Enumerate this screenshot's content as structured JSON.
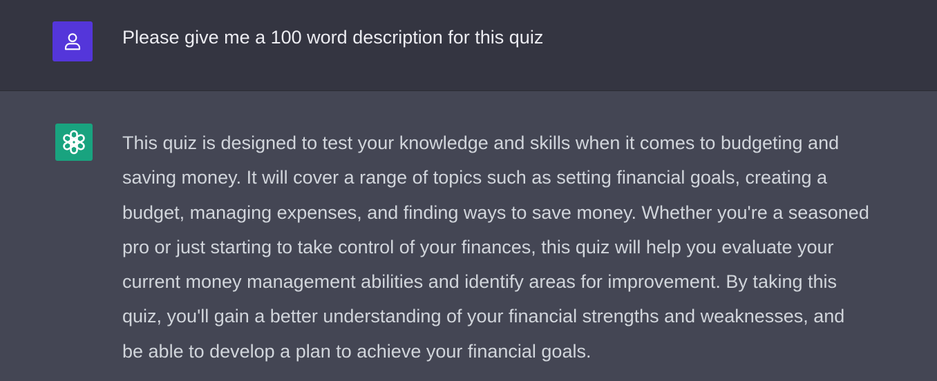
{
  "conversation": {
    "user_message": {
      "avatar_icon": "user-icon",
      "avatar_color": "#5436da",
      "text": "Please give me a 100 word description for this quiz"
    },
    "assistant_message": {
      "avatar_icon": "openai-logo-icon",
      "avatar_color": "#19a37f",
      "lines": [
        "This quiz is designed to test your knowledge and skills when it comes to budgeting and",
        "saving money. It will cover a range of topics such as setting financial goals, creating a",
        "budget, managing expenses, and finding ways to save money. Whether you're a seasoned",
        "pro or just starting to take control of your finances, this quiz will help you evaluate your",
        "current money management abilities and identify areas for improvement. By taking this",
        "quiz, you'll gain a better understanding of your financial strengths and weaknesses, and",
        "be able to develop a plan to achieve your financial goals."
      ]
    }
  }
}
